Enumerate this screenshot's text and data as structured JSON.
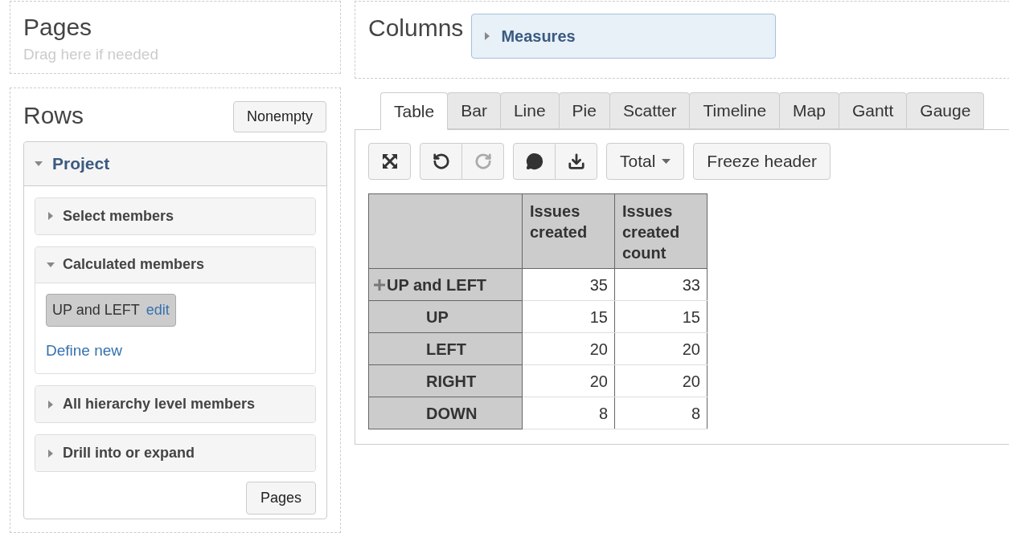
{
  "pages": {
    "title": "Pages",
    "hint": "Drag here if needed"
  },
  "rows_area": {
    "title": "Rows",
    "nonempty_button": "Nonempty",
    "dimension": {
      "label": "Project",
      "expanded": true,
      "sections": [
        {
          "title": "Select members",
          "expanded": false
        },
        {
          "title": "Calculated members",
          "expanded": true,
          "members": [
            {
              "label": "UP and LEFT",
              "edit": "edit"
            }
          ],
          "define_link": "Define new"
        },
        {
          "title": "All hierarchy level members",
          "expanded": false
        },
        {
          "title": "Drill into or expand",
          "expanded": false
        }
      ]
    },
    "pages_button": "Pages"
  },
  "columns_area": {
    "title": "Columns",
    "items": [
      {
        "label": "Measures",
        "expanded": false
      }
    ]
  },
  "tabs": [
    {
      "label": "Table",
      "selected": true
    },
    {
      "label": "Bar",
      "selected": false
    },
    {
      "label": "Line",
      "selected": false
    },
    {
      "label": "Pie",
      "selected": false
    },
    {
      "label": "Scatter",
      "selected": false
    },
    {
      "label": "Timeline",
      "selected": false
    },
    {
      "label": "Map",
      "selected": false
    },
    {
      "label": "Gantt",
      "selected": false
    },
    {
      "label": "Gauge",
      "selected": false
    }
  ],
  "toolbar": {
    "groups": [
      [
        {
          "kind": "fullscreen",
          "disabled": false
        }
      ],
      [
        {
          "kind": "undo",
          "disabled": false
        },
        {
          "kind": "redo",
          "disabled": true
        }
      ],
      [
        {
          "kind": "comment",
          "disabled": false
        },
        {
          "kind": "download",
          "disabled": false
        }
      ]
    ],
    "total_dropdown": "Total",
    "freeze_button": "Freeze header"
  },
  "table": {
    "columns": [
      "Issues created",
      "Issues created count"
    ],
    "rows": [
      {
        "label": "UP and LEFT",
        "expandable": true,
        "values": [
          "35",
          "33"
        ],
        "children": [
          {
            "label": "UP",
            "expandable": false,
            "values": [
              "15",
              "15"
            ]
          },
          {
            "label": "LEFT",
            "expandable": false,
            "values": [
              "20",
              "20"
            ]
          },
          {
            "label": "RIGHT",
            "expandable": false,
            "values": [
              "20",
              "20"
            ]
          },
          {
            "label": "DOWN",
            "expandable": false,
            "values": [
              "8",
              "8"
            ]
          }
        ]
      }
    ]
  }
}
